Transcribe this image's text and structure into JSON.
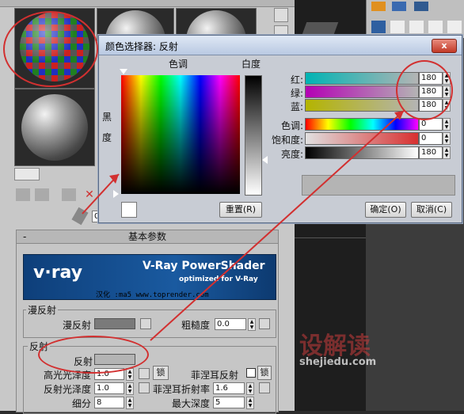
{
  "dialog": {
    "title": "颜色选择器: 反射",
    "close_label": "x",
    "hue_label": "色调",
    "whiteness_label": "白度",
    "blackness_label": "黑度",
    "channels": [
      {
        "label": "红:",
        "value": "180",
        "color": "#19c0c0"
      },
      {
        "label": "绿:",
        "value": "180",
        "color": "#c030c0"
      },
      {
        "label": "蓝:",
        "value": "180",
        "color": "#c0c020"
      }
    ],
    "hsv": [
      {
        "label": "色调:",
        "value": "0"
      },
      {
        "label": "饱和度:",
        "value": "0"
      },
      {
        "label": "亮度:",
        "value": "180"
      }
    ],
    "reset_label": "重置(R)",
    "ok_label": "确定(O)",
    "cancel_label": "取消(C)",
    "preview_color": "#b4b4b4"
  },
  "material": {
    "rollout_minus": "-",
    "rollout_title": "基本参数",
    "banner_title": "V-Ray PowerShader",
    "banner_logo": "v·ray",
    "banner_sub": "optimized for V-Ray",
    "banner_credit": "汉化 :ma5 www.toprender.com",
    "diffuse_group": "漫反射",
    "diffuse_label": "漫反射",
    "roughness_label": "粗糙度",
    "roughness_value": "0.0",
    "reflect_group": "反射",
    "reflect_label": "反射",
    "hilight_gloss_label": "高光光泽度",
    "hilight_gloss_value": "1.0",
    "refl_gloss_label": "反射光泽度",
    "refl_gloss_value": "1.0",
    "subdivs_label": "细分",
    "subdivs_value": "8",
    "lock_label": "锁",
    "fresnel_label": "菲涅耳反射",
    "fresnel_ior_label": "菲涅耳折射率",
    "fresnel_ior_value": "1.6",
    "max_depth_label": "最大深度",
    "max_depth_value": "5",
    "reflect_swatch": "#b4b4b4",
    "diffuse_swatch": "#7a7a7a"
  },
  "misc": {
    "field_zero": "0",
    "watermark_cn": "设解读",
    "watermark_url": "shejiedu.com"
  },
  "colors": {
    "accent_red": "#d23030"
  }
}
